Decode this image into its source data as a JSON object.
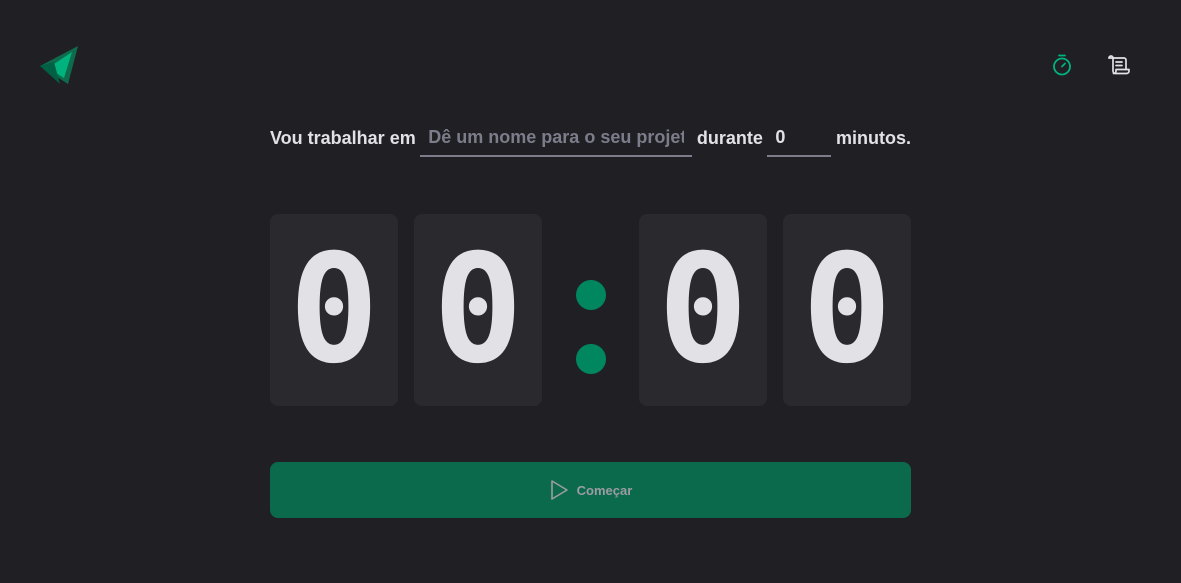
{
  "header": {
    "logo_icon": "ignite-triangle-logo",
    "nav": [
      {
        "icon": "timer-icon",
        "active": true
      },
      {
        "icon": "scroll-icon",
        "active": false
      }
    ]
  },
  "form": {
    "label_prefix": "Vou trabalhar em",
    "task_placeholder": "Dê um nome para o seu projeto",
    "task_value": "",
    "label_middle": "durante",
    "minutes_value": "0",
    "label_suffix": "minutos."
  },
  "countdown": {
    "minutes_tens": "0",
    "minutes_units": "0",
    "separator": ":",
    "seconds_tens": "0",
    "seconds_units": "0"
  },
  "start_button": {
    "label": "Começar",
    "icon": "play-icon"
  },
  "colors": {
    "background": "#202024",
    "card": "#29292e",
    "accent": "#00875f",
    "button": "#0b6a4b",
    "text": "#e1e1e6",
    "muted": "#7c7c8a"
  }
}
